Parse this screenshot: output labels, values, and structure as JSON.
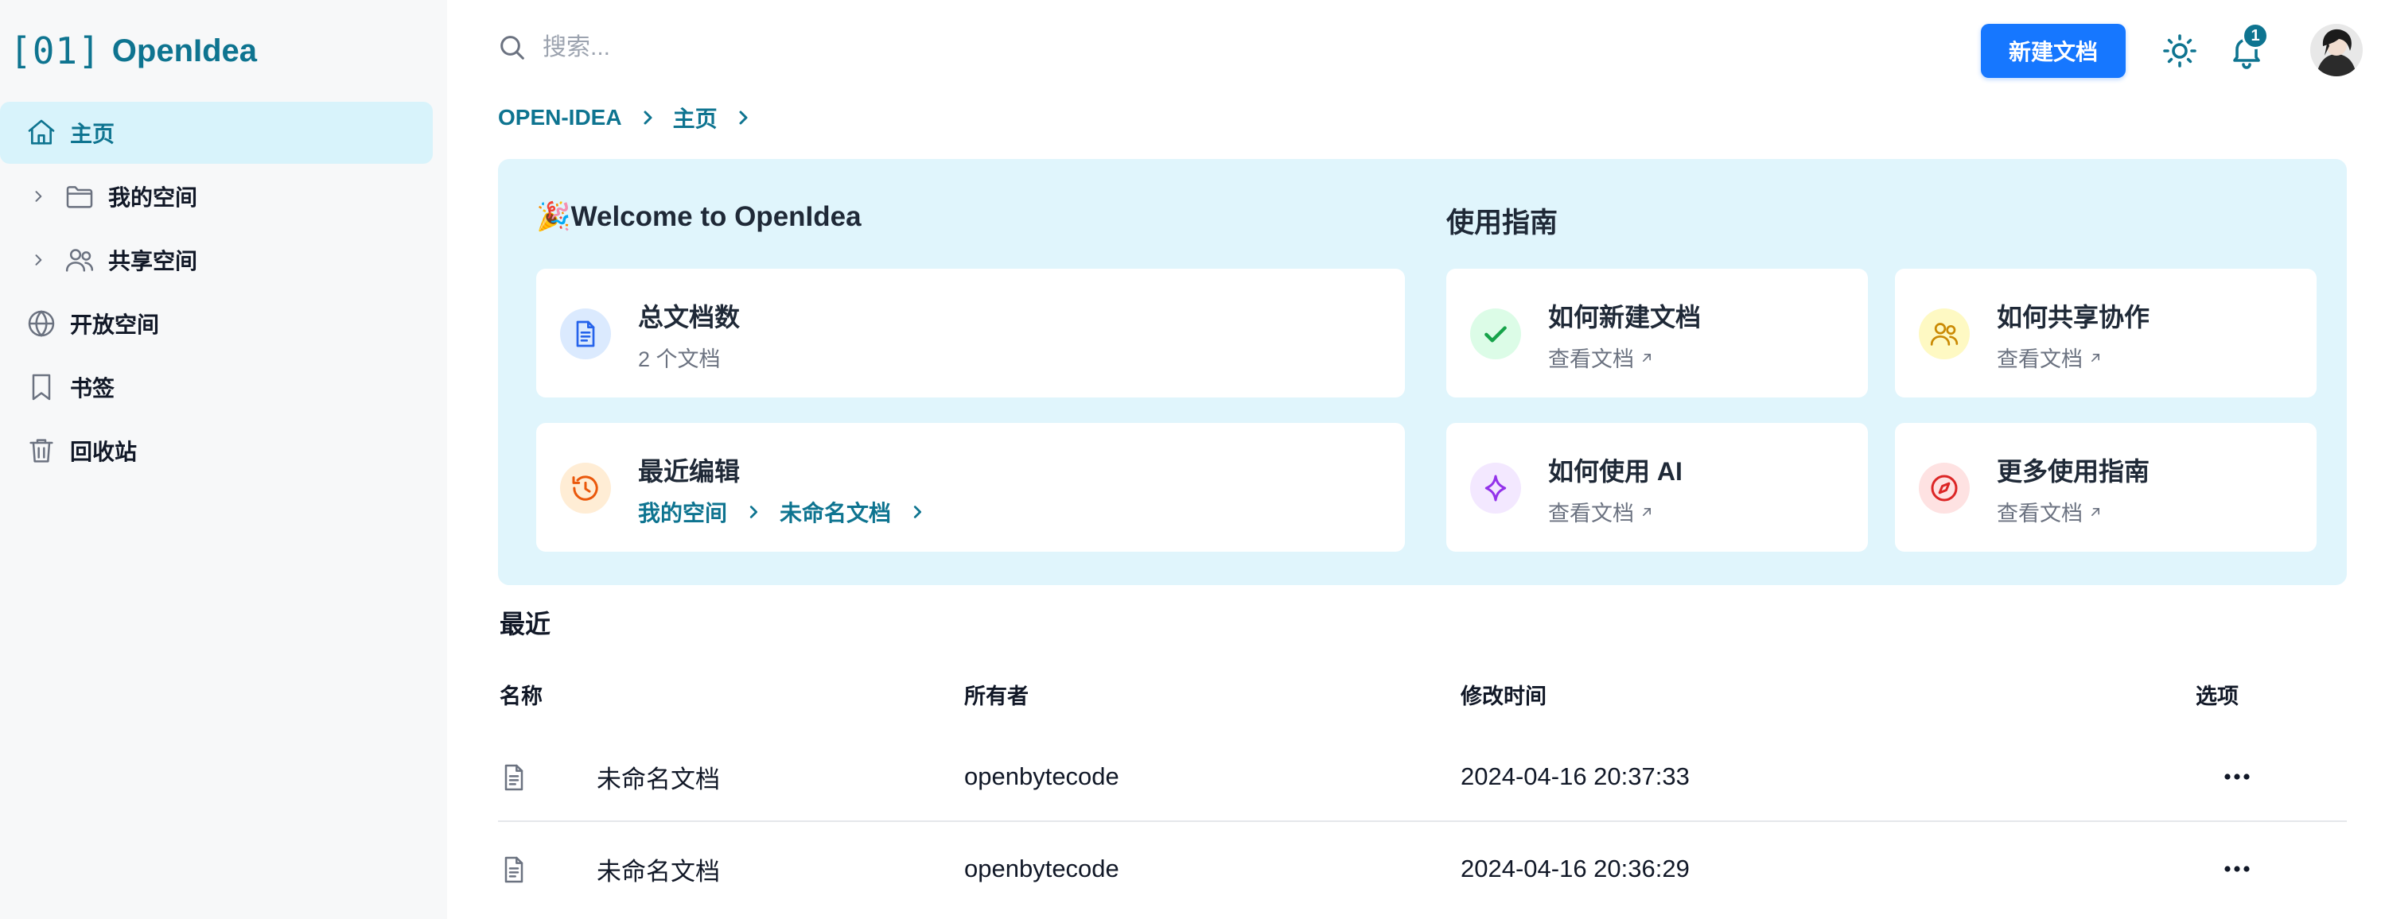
{
  "app": {
    "logo_mark": "[01]",
    "logo_text": "OpenIdea"
  },
  "sidebar": {
    "items": [
      {
        "label": "主页",
        "icon": "home-icon",
        "active": true
      },
      {
        "label": "我的空间",
        "icon": "folder-icon",
        "expandable": true
      },
      {
        "label": "共享空间",
        "icon": "users-icon",
        "expandable": true
      },
      {
        "label": "开放空间",
        "icon": "globe-icon"
      },
      {
        "label": "书签",
        "icon": "bookmark-icon"
      },
      {
        "label": "回收站",
        "icon": "trash-icon"
      }
    ]
  },
  "topbar": {
    "search_placeholder": "搜索...",
    "new_doc_label": "新建文档",
    "notification_count": "1"
  },
  "breadcrumb": [
    "OPEN-IDEA",
    "主页"
  ],
  "welcome": {
    "title": "🎉Welcome to OpenIdea",
    "total_docs": {
      "title": "总文档数",
      "value": "2 个文档"
    },
    "recent_edit": {
      "title": "最近编辑",
      "path": [
        "我的空间",
        "未命名文档"
      ]
    }
  },
  "guide": {
    "title": "使用指南",
    "items": [
      {
        "title": "如何新建文档",
        "link": "查看文档",
        "icon": "check-icon",
        "color": "#16a34a"
      },
      {
        "title": "如何共享协作",
        "link": "查看文档",
        "icon": "users-icon",
        "color": "#ca8a04"
      },
      {
        "title": "如何使用 AI",
        "link": "查看文档",
        "icon": "sparkle-icon",
        "color": "#9333ea"
      },
      {
        "title": "更多使用指南",
        "link": "查看文档",
        "icon": "compass-icon",
        "color": "#dc2626"
      }
    ]
  },
  "recent": {
    "title": "最近",
    "columns": {
      "name": "名称",
      "owner": "所有者",
      "modified": "修改时间",
      "options": "选项"
    },
    "rows": [
      {
        "name": "未命名文档",
        "owner": "openbytecode",
        "modified": "2024-04-16 20:37:33"
      },
      {
        "name": "未命名文档",
        "owner": "openbytecode",
        "modified": "2024-04-16 20:36:29"
      }
    ]
  },
  "colors": {
    "brand": "#0e7490",
    "primary_button": "#1677ff",
    "panel_bg": "#e0f5fc",
    "sidebar_bg": "#f7f8f9"
  }
}
